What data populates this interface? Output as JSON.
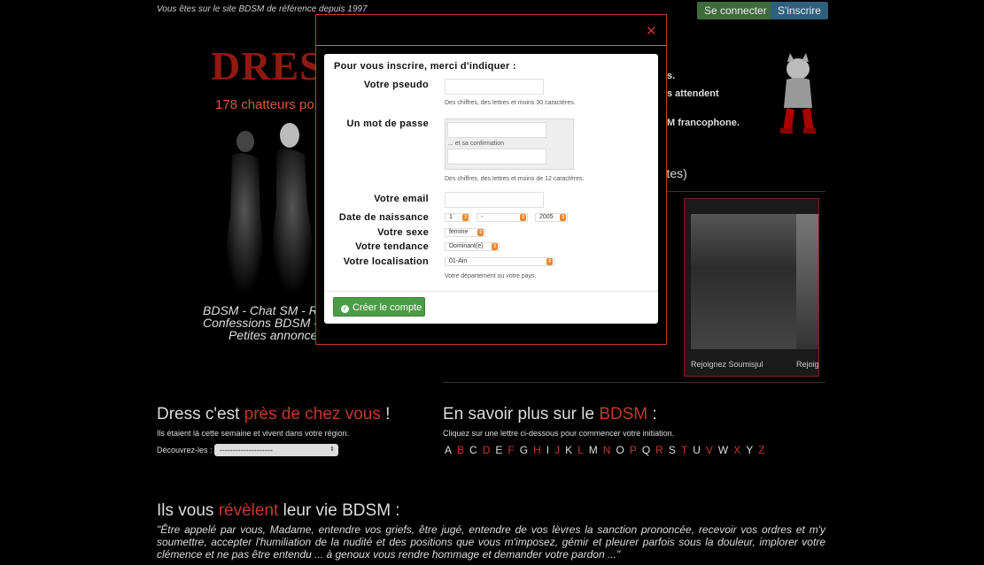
{
  "header": {
    "tagline": "Vous êtes sur le site BDSM de référence depuis 1997",
    "login_label": "Se connecter",
    "signup_label": "S'inscrire"
  },
  "hero": {
    "logo_text": "DRESS",
    "chatters_text": "178 chatteurs poin",
    "slogan_line1": "BDSM - Chat SM - Re",
    "slogan_line2": "Confessions BDSM -",
    "slogan_line3": "Petites annonces",
    "right_fragment1": "s.",
    "right_fragment2": "s attendent",
    "right_fragment3": "M francophone.",
    "alertes_fragment": "ertes)"
  },
  "featured": {
    "caption1": "Rejoignez Soumisjul",
    "caption2": "Rejoig"
  },
  "near_you": {
    "title_part1": "Dress c'est",
    "title_highlight": "près de chez vous",
    "title_part2": "!",
    "subtitle": "Ils étaient là cette semaine et vivent dans votre région.",
    "discover_label": "Découvrez-les :",
    "region_select": "--------------------"
  },
  "learn_more": {
    "title_part1": "En savoir plus sur le",
    "title_highlight": "BDSM",
    "title_part2": ":",
    "subtitle": "Cliquez sur une lettre ci-dessous pour commencer votre initiation.",
    "letters": [
      {
        "l": "A",
        "on": true
      },
      {
        "l": "B",
        "on": false
      },
      {
        "l": "C",
        "on": true
      },
      {
        "l": "D",
        "on": false
      },
      {
        "l": "E",
        "on": true
      },
      {
        "l": "F",
        "on": false
      },
      {
        "l": "G",
        "on": true
      },
      {
        "l": "H",
        "on": false
      },
      {
        "l": "I",
        "on": true
      },
      {
        "l": "J",
        "on": false
      },
      {
        "l": "K",
        "on": true
      },
      {
        "l": "L",
        "on": false
      },
      {
        "l": "M",
        "on": true
      },
      {
        "l": "N",
        "on": false
      },
      {
        "l": "O",
        "on": true
      },
      {
        "l": "P",
        "on": false
      },
      {
        "l": "Q",
        "on": true
      },
      {
        "l": "R",
        "on": false
      },
      {
        "l": "S",
        "on": true
      },
      {
        "l": "T",
        "on": false
      },
      {
        "l": "U",
        "on": true
      },
      {
        "l": "V",
        "on": false
      },
      {
        "l": "W",
        "on": true
      },
      {
        "l": "X",
        "on": false
      },
      {
        "l": "Y",
        "on": true
      },
      {
        "l": "Z",
        "on": false
      }
    ]
  },
  "reveal": {
    "title_part1": "Ils vous",
    "title_highlight": "révèlent",
    "title_part2": "leur vie BDSM :",
    "quote": "\"Être appelé par vous, Madame, entendre vos griefs, être jugé, entendre de vos lèvres la sanction prononcée, recevoir vos ordres et m'y soumettre, accepter l'humiliation de la nudité et des positions que vous m'imposez, gémir et pleurer parfois sous la douleur, implorer votre clémence et ne pas être entendu ... à genoux vous rendre hommage et demander votre pardon ...\""
  },
  "modal": {
    "close_symbol": "✕",
    "intro": "Pour vous inscrire, merci d'indiquer :",
    "pseudo_label": "Votre pseudo",
    "pseudo_value": "",
    "pseudo_hint": "Des chiffres, des lettres et moins 30 caractères.",
    "password_label": "Un mot de passe",
    "password_value": "",
    "confirm_hint": "... et sa confirmation",
    "confirm_value": "",
    "password_hint": "Des chiffres, des lettres et moins de 12 caractères.",
    "email_label": "Votre email",
    "email_value": "",
    "birth_label": "Date de naissance",
    "birth_day": "1",
    "birth_month": "-",
    "birth_year": "2005",
    "sex_label": "Votre sexe",
    "sex_value": "femme",
    "tendency_label": "Votre tendance",
    "tendency_value": "Dominant(e)",
    "location_label": "Votre localisation",
    "location_value": "01-Ain",
    "location_hint": "Votre département ou votre pays.",
    "create_label": "Créer le compte"
  },
  "colors": {
    "accent_red": "#c0392b",
    "login_green": "#3e6b3a",
    "signup_blue": "#2f5f7e",
    "create_green": "#4a9d45"
  }
}
